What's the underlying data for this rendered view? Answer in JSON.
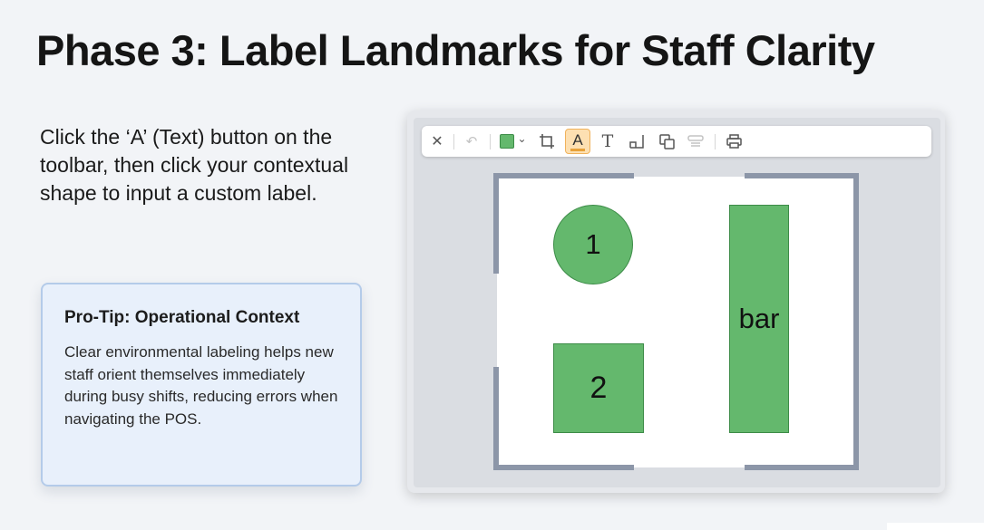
{
  "page": {
    "title": "Phase 3: Label Landmarks for Staff Clarity",
    "instruction": "Click the ‘A’ (Text) button on the toolbar, then click your contextual shape to input a custom label."
  },
  "tip": {
    "title": "Pro-Tip: Operational Context",
    "body": "Clear environmental labeling helps new staff orient themselves immediately during busy shifts, reducing errors when navigating the POS."
  },
  "toolbar": {
    "close": "✕",
    "undo": "↶",
    "fill_dropdown": "⌄",
    "crop": "⮺",
    "text_highlight": "A",
    "text": "T",
    "active_tool": "text-highlight",
    "fill_color": "#64b86d",
    "highlight_underline_color": "#e8a23a"
  },
  "canvas": {
    "shapes": [
      {
        "type": "circle",
        "label": "1"
      },
      {
        "type": "square",
        "label": "2"
      },
      {
        "type": "rectangle",
        "label": "bar"
      }
    ],
    "shape_color": "#64b86d",
    "wall_color": "#8c96a8"
  }
}
